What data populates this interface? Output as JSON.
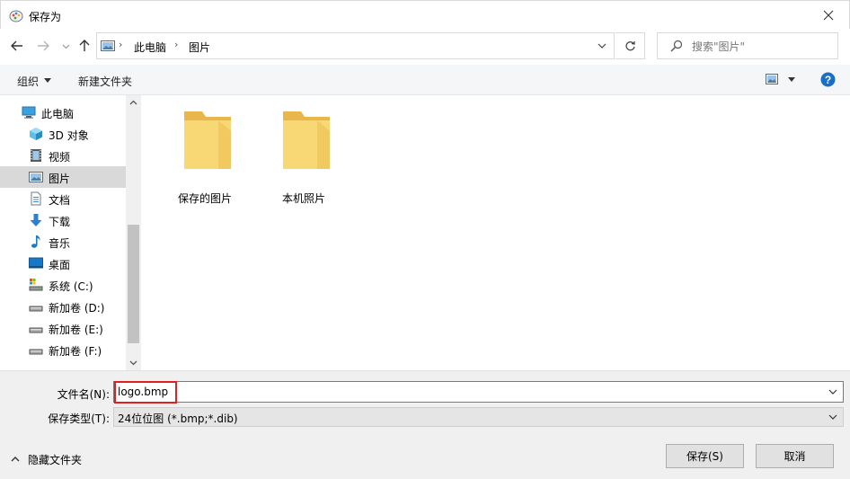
{
  "window": {
    "title": "保存为"
  },
  "breadcrumb": {
    "items": [
      "此电脑",
      "图片"
    ]
  },
  "search": {
    "placeholder": "搜索\"图片\""
  },
  "toolbar": {
    "organize_label": "组织",
    "new_folder_label": "新建文件夹"
  },
  "sidebar": {
    "items": [
      {
        "label": "此电脑",
        "icon": "computer-icon"
      },
      {
        "label": "3D 对象",
        "icon": "3d-objects-icon"
      },
      {
        "label": "视频",
        "icon": "videos-icon"
      },
      {
        "label": "图片",
        "icon": "pictures-icon",
        "selected": true
      },
      {
        "label": "文档",
        "icon": "documents-icon"
      },
      {
        "label": "下载",
        "icon": "downloads-icon"
      },
      {
        "label": "音乐",
        "icon": "music-icon"
      },
      {
        "label": "桌面",
        "icon": "desktop-icon"
      },
      {
        "label": "系统 (C:)",
        "icon": "system-drive-icon"
      },
      {
        "label": "新加卷 (D:)",
        "icon": "drive-icon"
      },
      {
        "label": "新加卷 (E:)",
        "icon": "drive-icon"
      },
      {
        "label": "新加卷 (F:)",
        "icon": "drive-icon"
      }
    ]
  },
  "content": {
    "folders": [
      {
        "label": "保存的图片",
        "icon": "folder-icon"
      },
      {
        "label": "本机照片",
        "icon": "folder-icon"
      }
    ]
  },
  "form": {
    "filename_label": "文件名(N):",
    "filename_value": "logo.bmp",
    "filetype_label": "保存类型(T):",
    "filetype_value": "24位位图 (*.bmp;*.dib)"
  },
  "footer": {
    "hide_folders_label": "隐藏文件夹",
    "save_label": "保存(S)",
    "cancel_label": "取消"
  },
  "colors": {
    "folder_yellow": "#f8d775",
    "selection_gray": "#d9d9d9",
    "highlight_red": "#e02020",
    "help_blue": "#1a6fc4"
  }
}
